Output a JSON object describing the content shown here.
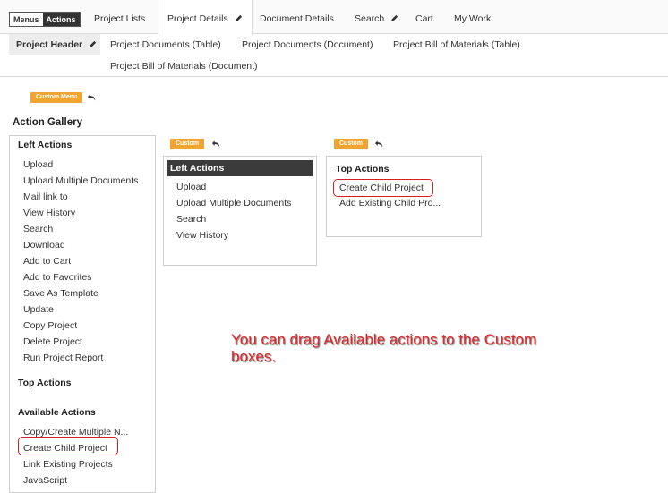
{
  "topbar": {
    "toggle": {
      "off_label": "Menus",
      "on_label": "Actions"
    },
    "tabs": [
      {
        "label": "Project Lists"
      },
      {
        "label": "Project Details"
      },
      {
        "label": "Document Details"
      },
      {
        "label": "Search"
      },
      {
        "label": "Cart"
      },
      {
        "label": "My Work"
      }
    ]
  },
  "subnav": {
    "items": [
      {
        "label": "Project Header"
      },
      {
        "label": "Project Documents (Table)"
      },
      {
        "label": "Project Documents (Document)"
      },
      {
        "label": "Project Bill of Materials (Table)"
      },
      {
        "label": "Project Bill of Materials (Document)"
      }
    ]
  },
  "custom_menu_badge": "Custom Menu",
  "action_gallery": {
    "title": "Action Gallery",
    "left_actions_heading": "Left Actions",
    "left_actions": [
      "Upload",
      "Upload Multiple Documents",
      "Mail link to",
      "View History",
      "Search",
      "Download",
      "Add to Cart",
      "Add to Favorites",
      "Save As Template",
      "Update",
      "Copy Project",
      "Delete Project",
      "Run Project Report"
    ],
    "top_actions_heading": "Top Actions",
    "available_heading": "Available Actions",
    "available_actions": [
      "Copy/Create Multiple N...",
      "Create Child Project",
      "Link Existing Projects",
      "JavaScript"
    ]
  },
  "custom_left": {
    "badge": "Custom",
    "title": "Left Actions",
    "items": [
      "Upload",
      "Upload Multiple Documents",
      "Search",
      "View History"
    ]
  },
  "custom_top": {
    "badge": "Custom",
    "title": "Top Actions",
    "items": [
      "Create Child Project",
      "Add Existing Child Pro..."
    ]
  },
  "callout": "You can drag Available actions to the Custom boxes.",
  "colors": {
    "badge": "#f0a530",
    "highlight": "#d42020",
    "callout": "#e3262a",
    "dark_header": "#3b3b3b"
  }
}
